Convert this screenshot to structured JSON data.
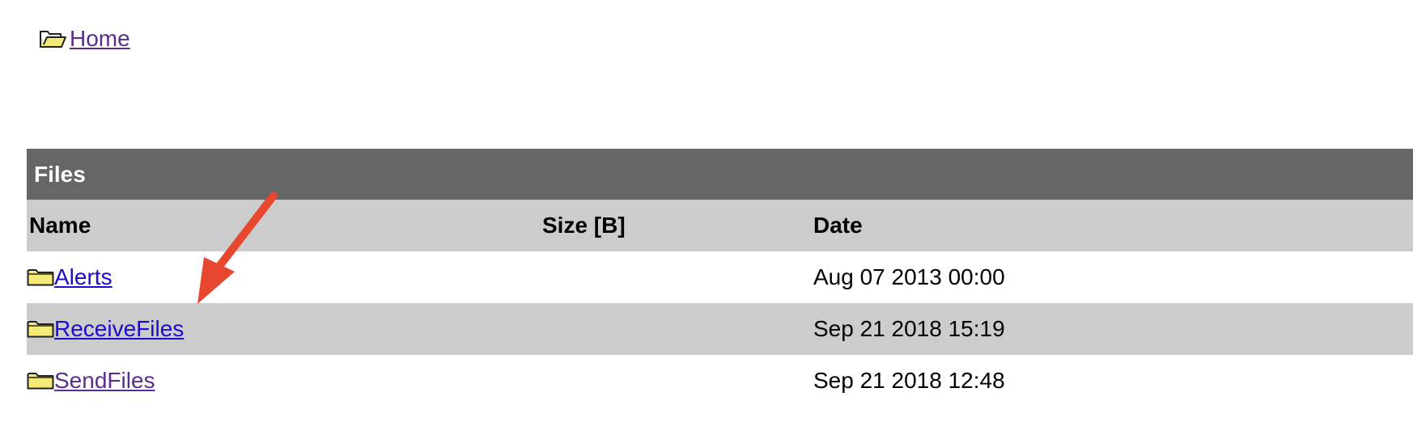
{
  "breadcrumb": {
    "icon": "open-folder-icon",
    "home_label": " Home"
  },
  "files_table": {
    "title": "Files",
    "columns": {
      "name": "Name",
      "size": "Size [B]",
      "date": "Date"
    },
    "rows": [
      {
        "icon": "folder-icon",
        "name": "Alerts",
        "size": "",
        "date": "Aug 07 2013 00:00",
        "link_state": "unvisited"
      },
      {
        "icon": "folder-icon",
        "name": "ReceiveFiles",
        "size": "",
        "date": "Sep 21 2018 15:19",
        "link_state": "unvisited"
      },
      {
        "icon": "folder-icon",
        "name": "SendFiles",
        "size": "",
        "date": "Sep 21 2018 12:48",
        "link_state": "visited"
      }
    ]
  },
  "annotation": {
    "type": "arrow",
    "points_to": "ReceiveFiles",
    "color": "#e8472f"
  },
  "colors": {
    "title_bar": "#666666",
    "header_and_alt_row": "#cccccc",
    "link_unvisited": "#1a0dcc",
    "link_visited": "#5b2d8c",
    "folder_fill": "#f5e97a"
  }
}
